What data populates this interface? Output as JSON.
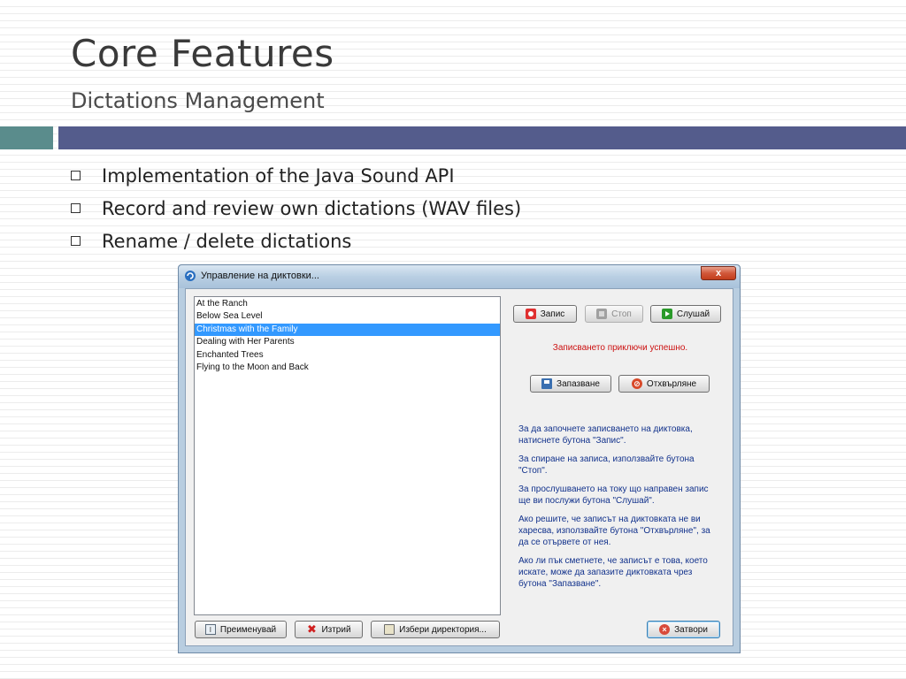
{
  "slide": {
    "title": "Core Features",
    "subtitle": "Dictations Management",
    "bullets": [
      "Implementation of the Java Sound API",
      "Record and review own dictations (WAV files)",
      "Rename / delete dictations"
    ]
  },
  "window": {
    "title": "Управление на диктовки...",
    "close_glyph": "x",
    "list": [
      "At the Ranch",
      "Below Sea Level",
      "Christmas with the Family",
      "Dealing with Her Parents",
      "Enchanted Trees",
      "Flying to the Moon and Back"
    ],
    "selected_index": 2,
    "buttons": {
      "record": "Запис",
      "stop": "Стоп",
      "play": "Слушай",
      "save": "Запазване",
      "reject": "Отхвърляне",
      "rename": "Преименувай",
      "delete": "Изтрий",
      "choose_dir": "Избери директория...",
      "close": "Затвори"
    },
    "status": "Записването приключи успешно.",
    "help": [
      "За да започнете записването на диктовка, натиснете бутона \"Запис\".",
      "За спиране на записа, използвайте бутона \"Стоп\".",
      "За прослушването на току що направен запис ще ви послужи бутона \"Слушай\".",
      "Ако решите, че записът на диктовката не ви харесва, използвайте бутона \"Отхвърляне\", за да се отървете от нея.",
      "Ако ли пък сметнете, че записът е това, което искате, може да запазите диктовката чрез бутона \"Запазване\"."
    ]
  },
  "colors": {
    "accent_band": "#545c8c",
    "accent_band_left": "#5a8c8c",
    "selection": "#3399ff",
    "status_text": "#cc1111",
    "help_text": "#12328c"
  }
}
